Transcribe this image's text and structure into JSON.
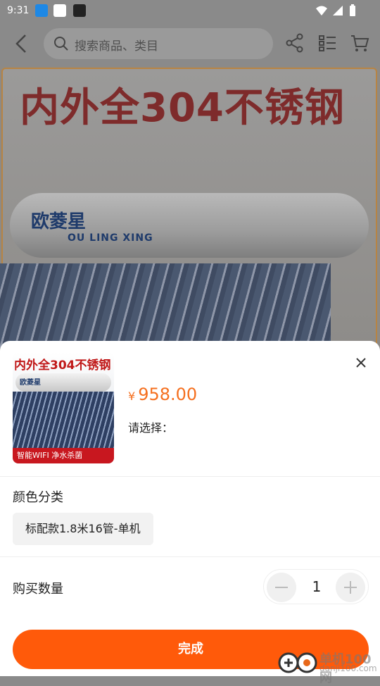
{
  "status_bar": {
    "time": "9:31"
  },
  "header": {
    "search_placeholder": "搜索商品、类目"
  },
  "banner": {
    "headline": "内外全304不锈钢",
    "brand_cn": "欧菱星",
    "brand_en": "OU LING XING"
  },
  "sheet": {
    "thumb_headline": "内外全304不锈钢",
    "thumb_brand": "欧菱星",
    "thumb_strip": "智能WIFI 净水杀菌",
    "price_currency": "¥",
    "price": "958.00",
    "choose_label": "请选择：",
    "color_section_label": "颜色分类",
    "color_option": "标配款1.8米16管-单机",
    "quantity_label": "购买数量",
    "quantity": "1",
    "confirm_button": "完成"
  },
  "watermark": {
    "line1": "单机100网",
    "line2": "danji100.com"
  },
  "colors": {
    "accent": "#ff5a0a",
    "price": "#f56f1e"
  },
  "icons": [
    "back-icon",
    "search-icon",
    "share-icon",
    "list-icon",
    "cart-icon",
    "close-icon",
    "minus-icon",
    "plus-icon"
  ]
}
